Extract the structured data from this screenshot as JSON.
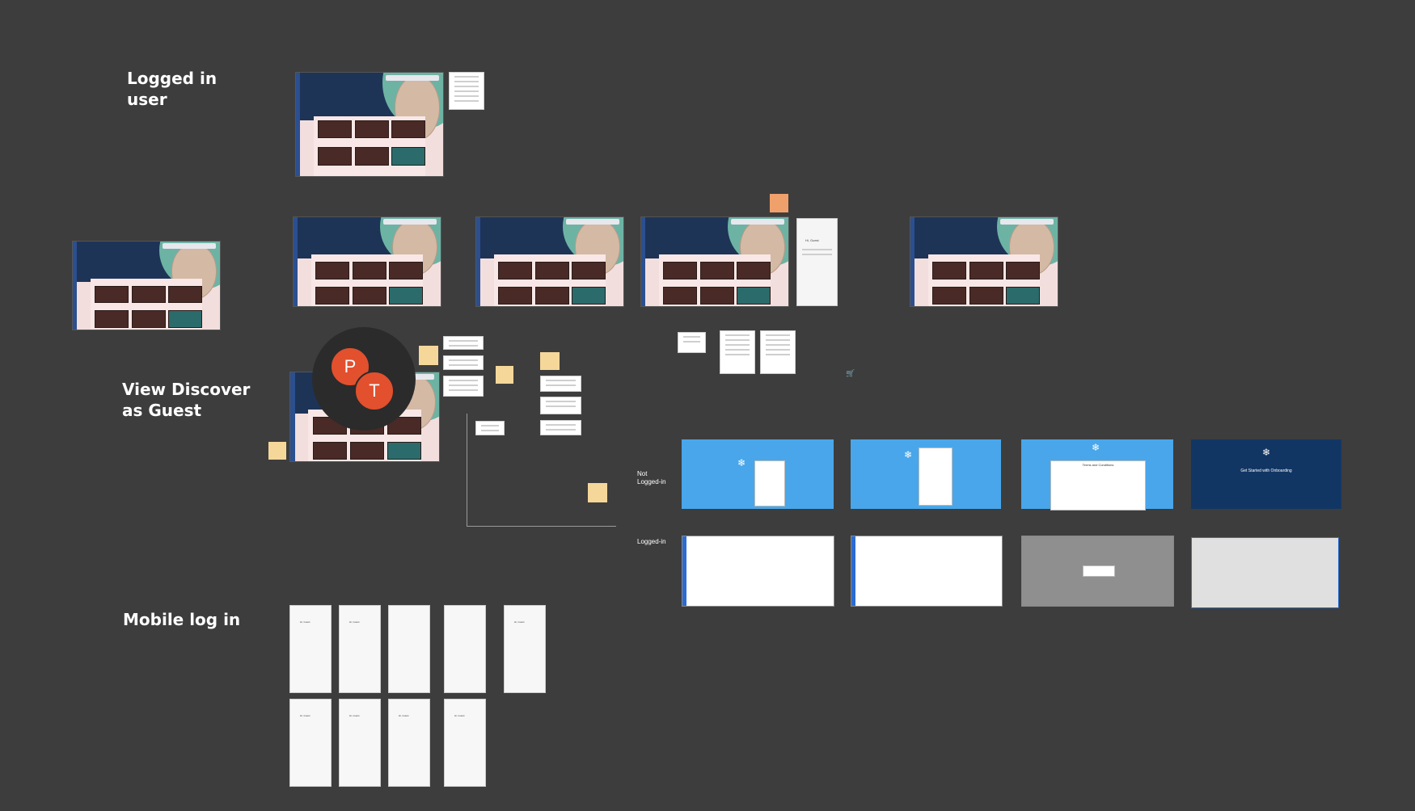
{
  "sections": {
    "logged_in_user": "Logged in\nuser",
    "view_discover_guest": "View Discover\nas Guest",
    "mobile_log_in": "Mobile log in"
  },
  "flow_labels": {
    "not_logged_in": "Not\nLogged-in",
    "logged_in": "Logged-in"
  },
  "avatars": [
    {
      "initial": "P"
    },
    {
      "initial": "T"
    }
  ],
  "mobile_screens": [
    {
      "greeting": "Hi, Guest"
    },
    {
      "greeting": "Hi, Guest"
    },
    {
      "greeting": ""
    },
    {
      "greeting": ""
    },
    {
      "greeting": "Hi, Guest"
    },
    {
      "greeting": "Hi, Guest"
    },
    {
      "greeting": "Hi, Guest"
    },
    {
      "greeting": "Hi, Guest"
    },
    {
      "greeting": "Hi, Guest"
    }
  ],
  "onboarding": {
    "terms_title": "Terms and Conditions",
    "get_started": "Get Started with Onboarding"
  },
  "guest_panel": {
    "greeting": "Hi, Guest"
  },
  "colors": {
    "canvas": "#3d3d3d",
    "avatar": "#e2502e",
    "sticky": "#f5d79a",
    "sticky_orange": "#f0a06b",
    "flow_blue": "#49a6ea",
    "flow_navy": "#123664"
  }
}
